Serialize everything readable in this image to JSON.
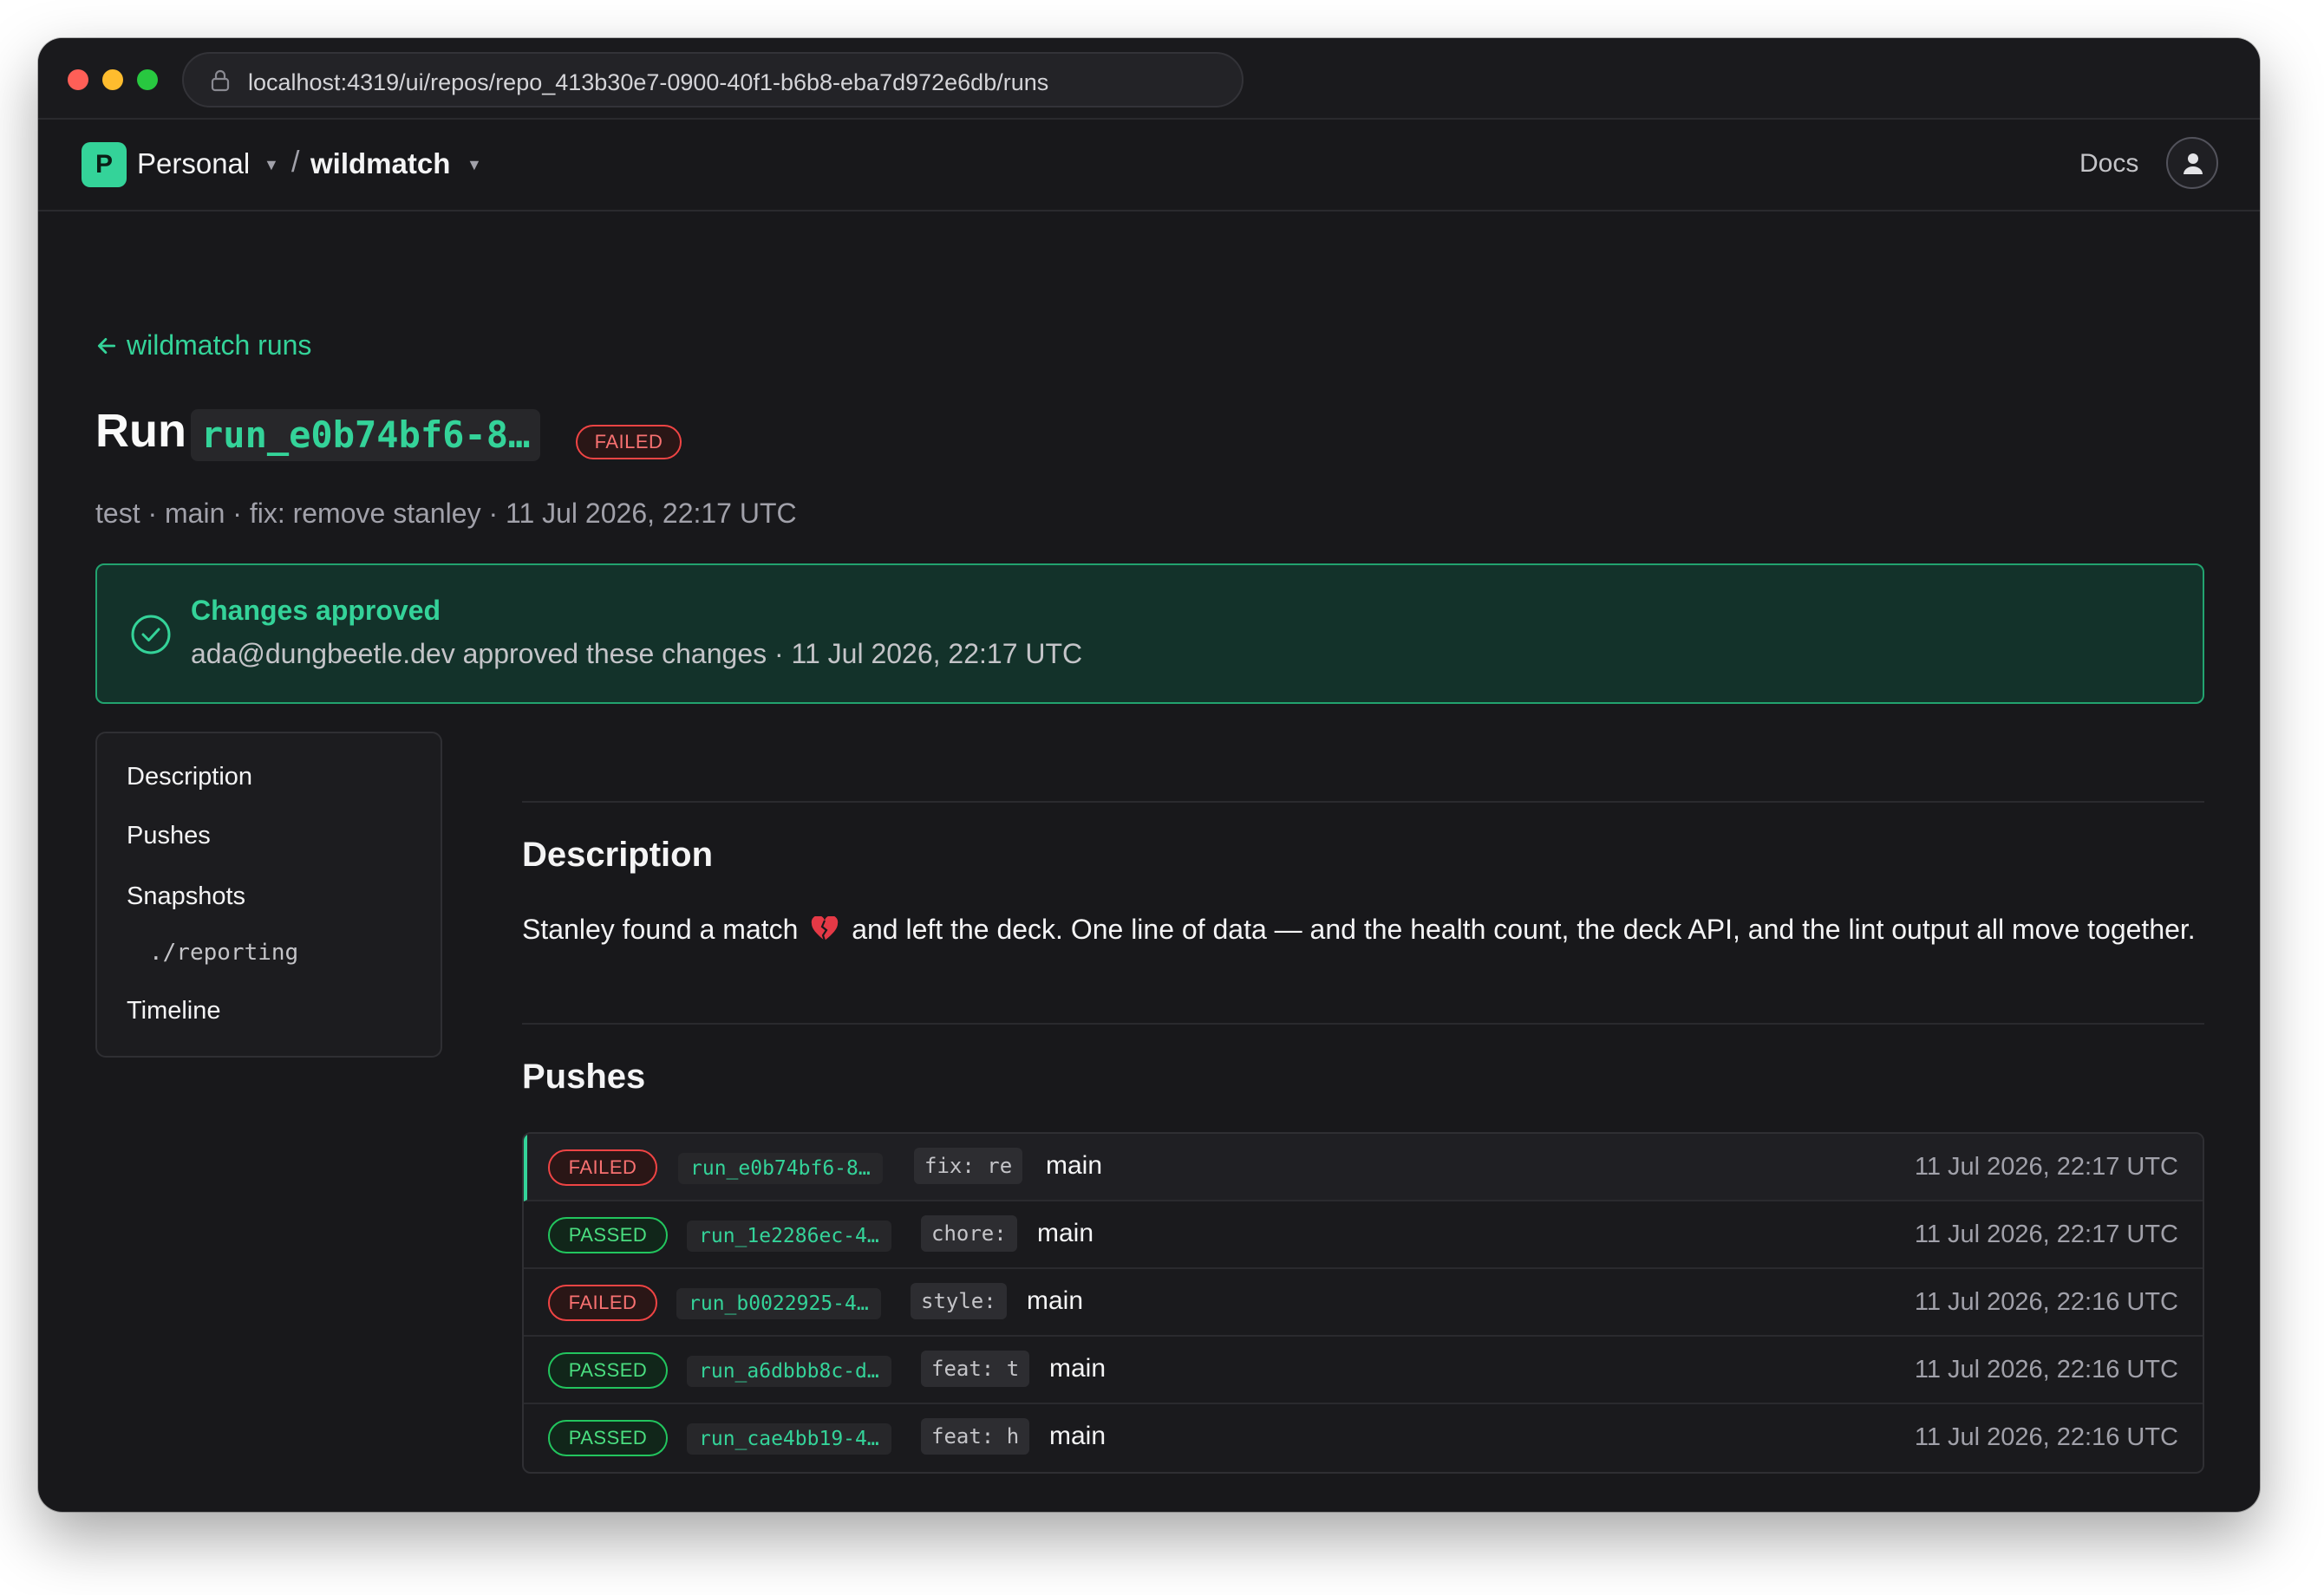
{
  "browser": {
    "url": "localhost:4319/ui/repos/repo_413b30e7-0900-40f1-b6b8-eba7d972e6db/runs"
  },
  "header": {
    "org_initial": "P",
    "org_name": "Personal",
    "separator": "/",
    "repo_name": "wildmatch",
    "docs_label": "Docs"
  },
  "page": {
    "back_label": "wildmatch runs",
    "title_prefix": "Run",
    "run_id": "run_e0b74bf6-8…",
    "status": "FAILED",
    "meta": "test · main · fix: remove stanley · 11 Jul 2026, 22:17 UTC"
  },
  "approval": {
    "title": "Changes approved",
    "description": "ada@dungbeetle.dev approved these changes · 11 Jul 2026, 22:17 UTC"
  },
  "sidenav": {
    "items": [
      {
        "label": "Description"
      },
      {
        "label": "Pushes"
      },
      {
        "label": "Snapshots"
      },
      {
        "label": "./reporting"
      },
      {
        "label": "Timeline"
      }
    ]
  },
  "description": {
    "heading": "Description",
    "text_before": "Stanley found a match",
    "text_after": "and left the deck. One line of data — and the health count, the deck API, and the lint output all move together."
  },
  "pushes": {
    "heading": "Pushes",
    "rows": [
      {
        "status": "FAILED",
        "run_id": "run_e0b74bf6-8…",
        "message": "fix: re",
        "branch": "main",
        "time": "11 Jul 2026, 22:17 UTC"
      },
      {
        "status": "PASSED",
        "run_id": "run_1e2286ec-4…",
        "message": "chore:",
        "branch": "main",
        "time": "11 Jul 2026, 22:17 UTC"
      },
      {
        "status": "FAILED",
        "run_id": "run_b0022925-4…",
        "message": "style:",
        "branch": "main",
        "time": "11 Jul 2026, 22:16 UTC"
      },
      {
        "status": "PASSED",
        "run_id": "run_a6dbbb8c-d…",
        "message": "feat: t",
        "branch": "main",
        "time": "11 Jul 2026, 22:16 UTC"
      },
      {
        "status": "PASSED",
        "run_id": "run_cae4bb19-4…",
        "message": "feat: h",
        "branch": "main",
        "time": "11 Jul 2026, 22:16 UTC"
      }
    ]
  },
  "colors": {
    "accent": "#34d399",
    "failed": "#ef4444",
    "passed": "#22c55e",
    "background": "#18181b"
  },
  "icons": {
    "lock": "lock-icon",
    "back": "arrow-left-icon",
    "approved": "check-circle-icon",
    "avatar": "user-icon",
    "emoji": "broken-heart-icon"
  }
}
